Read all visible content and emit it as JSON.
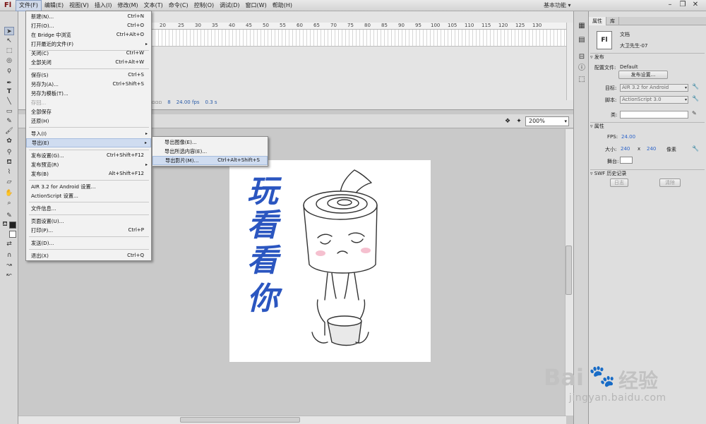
{
  "app": {
    "logo": "Fl"
  },
  "menubar": {
    "items": [
      "文件(F)",
      "编辑(E)",
      "视图(V)",
      "插入(I)",
      "修改(M)",
      "文本(T)",
      "命令(C)",
      "控制(O)",
      "调试(D)",
      "窗口(W)",
      "帮助(H)"
    ],
    "workspace": "基本功能",
    "workspace_arrow": "▾",
    "window_controls": [
      "–",
      "❐",
      "✕"
    ]
  },
  "file_menu": {
    "items": [
      {
        "label": "新建(N)...",
        "shortcut": "Ctrl+N"
      },
      {
        "label": "打开(O)...",
        "shortcut": "Ctrl+O"
      },
      {
        "label": "在 Bridge 中浏览",
        "shortcut": "Ctrl+Alt+O"
      },
      {
        "label": "打开最近的文件(F)",
        "submenu": "▸"
      },
      {
        "label": "关闭(C)",
        "shortcut": "Ctrl+W"
      },
      {
        "label": "全部关闭",
        "shortcut": "Ctrl+Alt+W"
      },
      {
        "label": "保存(S)",
        "shortcut": "Ctrl+S"
      },
      {
        "label": "另存为(A)...",
        "shortcut": "Ctrl+Shift+S"
      },
      {
        "label": "另存为模板(T)..."
      },
      {
        "label": "存回..."
      },
      {
        "label": "全部保存"
      },
      {
        "label": "还原(H)"
      },
      {
        "label": "导入(I)",
        "submenu": "▸"
      },
      {
        "label": "导出(E)",
        "submenu": "▸"
      },
      {
        "label": "发布设置(G)...",
        "shortcut": "Ctrl+Shift+F12"
      },
      {
        "label": "发布预览(R)",
        "submenu": "▸"
      },
      {
        "label": "发布(B)",
        "shortcut": "Alt+Shift+F12"
      },
      {
        "label": "AIR 3.2 for Android 设置..."
      },
      {
        "label": "ActionScript 设置..."
      },
      {
        "label": "文件信息..."
      },
      {
        "label": "页面设置(U)..."
      },
      {
        "label": "打印(P)...",
        "shortcut": "Ctrl+P"
      },
      {
        "label": "发送(D)..."
      },
      {
        "label": "退出(X)",
        "shortcut": "Ctrl+Q"
      }
    ]
  },
  "export_submenu": {
    "items": [
      {
        "label": "导出图像(E)..."
      },
      {
        "label": "导出所选内容(E)..."
      },
      {
        "label": "导出影片(M)...",
        "shortcut": "Ctrl+Alt+Shift+S"
      }
    ]
  },
  "timeline": {
    "ruler": [
      "20",
      "25",
      "30",
      "35",
      "40",
      "45",
      "50",
      "55",
      "60",
      "65",
      "70",
      "75",
      "80",
      "85",
      "90",
      "95",
      "100",
      "105",
      "110",
      "115",
      "120",
      "125",
      "130"
    ],
    "current_frame": "8",
    "fps": "24.00",
    "fps_unit": "fps",
    "time": "0.3 s"
  },
  "stage": {
    "zoom": "200%",
    "zoom_arrow": "▾",
    "calligraphy": [
      "玩",
      "看",
      "看",
      "你"
    ]
  },
  "properties": {
    "tabs": [
      "属性",
      "库"
    ],
    "doc_icon": "Fl",
    "doc_type": "文档",
    "doc_name": "大卫先生-07",
    "publish": {
      "section": "发布",
      "profile_label": "配置文件:",
      "profile_value": "Default",
      "settings_button": "发布设置...",
      "target_label": "目标:",
      "target_value": "AIR 3.2 for Android",
      "script_label": "脚本:",
      "script_value": "ActionScript 3.0",
      "class_label": "类:"
    },
    "attributes": {
      "section": "属性",
      "fps_label": "FPS:",
      "fps_value": "24.00",
      "size_label": "大小:",
      "width": "240",
      "x": "x",
      "height": "240",
      "unit": "像素",
      "stage_label": "舞台:"
    },
    "swf_history": {
      "section": "SWF 历史记录",
      "log_button": "日志",
      "clear_button": "清除"
    }
  },
  "watermark": {
    "logo_text": "Bai",
    "logo_suffix": "经验",
    "url": "jingyan.baidu.com"
  }
}
